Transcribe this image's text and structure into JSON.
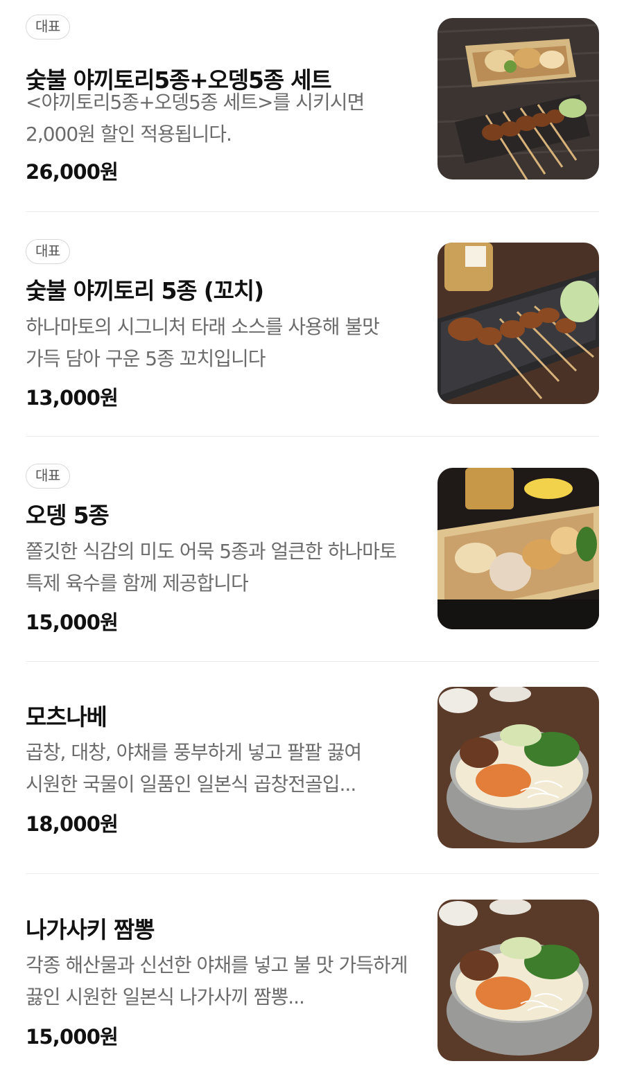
{
  "menu": {
    "items": [
      {
        "badge": "대표",
        "name": "숯불 야끼토리5종+오뎅5종 세트",
        "description": "<야끼토리5종+오뎅5종 세트>를 시키시면 2,000원 할인 적용됩니다.",
        "price": "26,000원",
        "image": "yakitori-oden-set-photo"
      },
      {
        "badge": "대표",
        "name": "숯불 야끼토리 5종 (꼬치)",
        "description": "하나마토의 시그니처 타래 소스를 사용해 불맛 가득 담아 구운 5종 꼬치입니다",
        "price": "13,000원",
        "image": "yakitori-skewers-photo"
      },
      {
        "badge": "대표",
        "name": "오뎅 5종",
        "description": "쫄깃한 식감의 미도 어묵 5종과 얼큰한 하나마토 특제 육수를 함께 제공합니다",
        "price": "15,000원",
        "image": "oden-box-photo"
      },
      {
        "name": "모츠나베",
        "description": "곱창, 대창, 야채를 풍부하게 넣고 팔팔 끓여 시원한 국물이 일품인 일본식 곱창전골입...",
        "price": "18,000원",
        "image": "hotpot-photo"
      },
      {
        "name": "나가사키 짬뽕",
        "description": "각종 해산물과 신선한 야채를 넣고 불 맛 가득하게 끓인 시원한 일본식 나가사끼 짬뽕...",
        "price": "15,000원",
        "image": "hotpot-photo"
      }
    ]
  }
}
